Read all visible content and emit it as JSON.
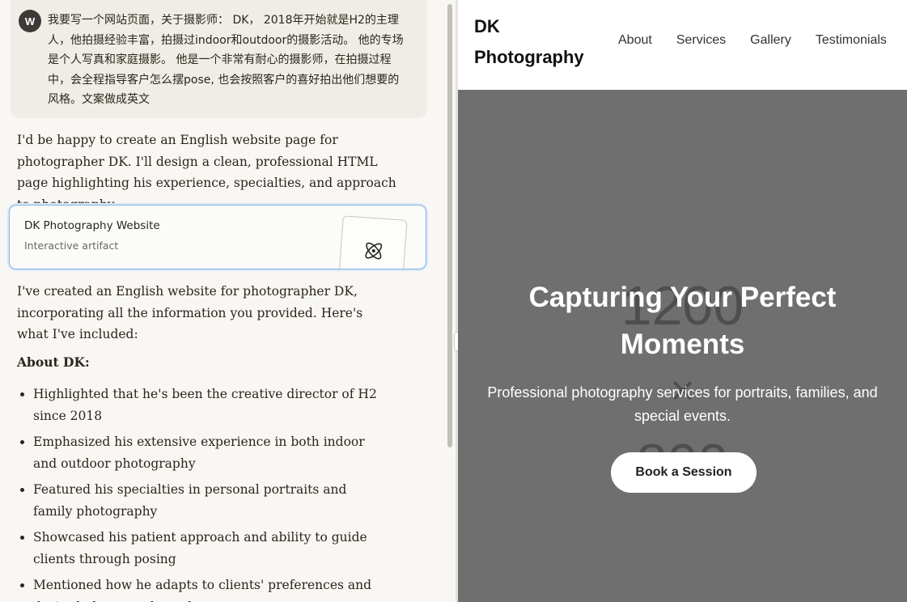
{
  "chat": {
    "user": {
      "avatar_letter": "W",
      "message": "我要写一个网站页面，关于摄影师： DK， 2018年开始就是H2的主理人，他拍摄经验丰富，拍摄过indoor和outdoor的摄影活动。 他的专场是个人写真和家庭摄影。 他是一个非常有耐心的摄影师，在拍摄过程中，会全程指导客户怎么摆pose, 也会按照客户的喜好拍出他们想要的风格。文案做成英文"
    },
    "assistant_intro": "I'd be happy to create an English website page for photographer DK. I'll design a clean, professional HTML page highlighting his experience, specialties, and approach to photography.",
    "artifact": {
      "title": "DK Photography Website",
      "subtitle": "Interactive artifact",
      "icon": "atom-icon"
    },
    "assistant_followup": "I've created an English website for photographer DK, incorporating all the information you provided. Here's what I've included:",
    "section_heading": "About DK:",
    "bullets": [
      "Highlighted that he's been the creative director of H2 since 2018",
      "Emphasized his extensive experience in both indoor and outdoor photography",
      "Featured his specialties in personal portraits and family photography",
      "Showcased his patient approach and ability to guide clients through posing",
      "Mentioned how he adapts to clients' preferences and desired photography styles"
    ]
  },
  "preview": {
    "logo": "DK Photography",
    "nav": [
      "About",
      "Services",
      "Gallery",
      "Testimonials"
    ],
    "hero": {
      "placeholder_width": "1200",
      "placeholder_x": "×",
      "placeholder_height": "800",
      "title": "Capturing Your Perfect Moments",
      "subtitle": "Professional photography services for portraits, families, and special events.",
      "cta": "Book a Session",
      "bg_color": "#6f6f6f"
    }
  },
  "colors": {
    "chat_bg": "#f8f7f3",
    "user_bubble": "#efede6",
    "artifact_border": "#86b2e8"
  }
}
